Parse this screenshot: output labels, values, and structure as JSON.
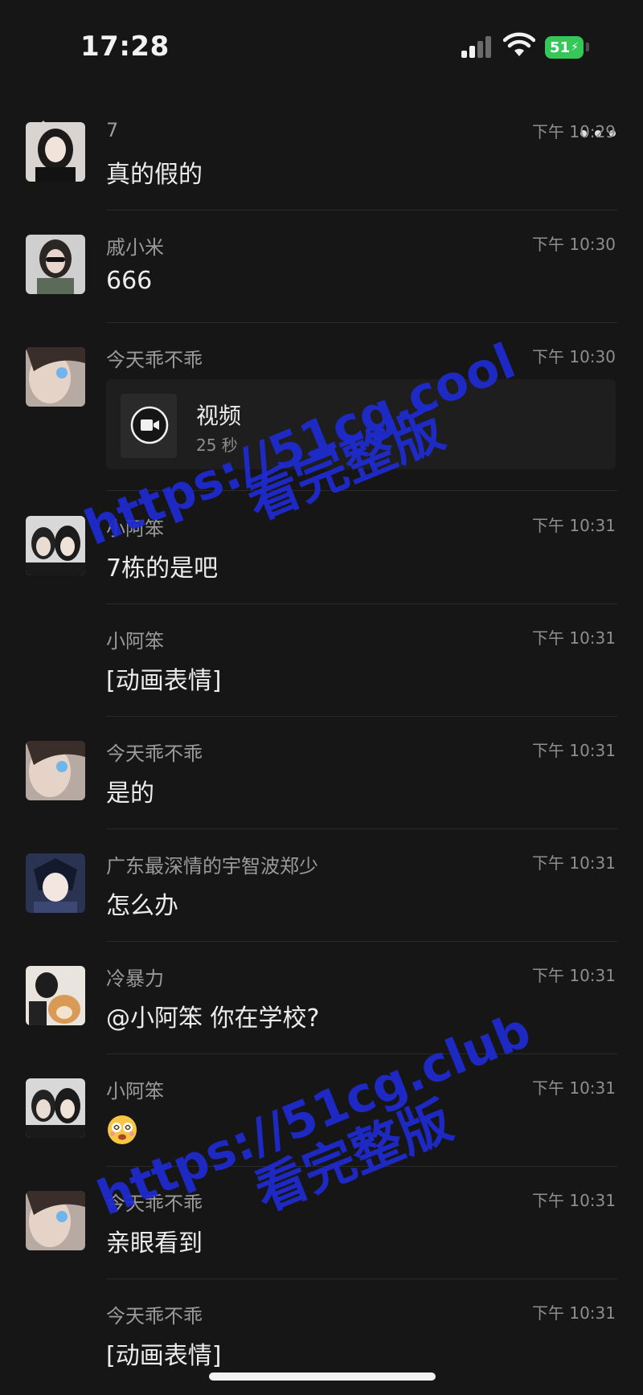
{
  "status_bar": {
    "time": "17:28",
    "battery": "51"
  },
  "messages": [
    {
      "sender": "7",
      "time": "下午 10:29",
      "text": "真的假的",
      "type": "text",
      "avatar": "avatar-girl-dark-hair"
    },
    {
      "sender": "戚小米",
      "time": "下午 10:30",
      "text": "666",
      "type": "text",
      "avatar": "avatar-girl-sunglasses"
    },
    {
      "sender": "今天乖不乖",
      "time": "下午 10:30",
      "type": "video",
      "video": {
        "title": "视频",
        "duration": "25 秒"
      },
      "avatar": "avatar-girl-blue-eye"
    },
    {
      "sender": "小阿笨",
      "time": "下午 10:31",
      "text": "7栋的是吧",
      "type": "text",
      "avatar": "avatar-couple"
    },
    {
      "sender": "小阿笨",
      "time": "下午 10:31",
      "text": "[动画表情]",
      "type": "text",
      "avatar": ""
    },
    {
      "sender": "今天乖不乖",
      "time": "下午 10:31",
      "text": "是的",
      "type": "text",
      "avatar": "avatar-girl-blue-eye"
    },
    {
      "sender": "广东最深情的宇智波郑少",
      "time": "下午 10:31",
      "text": "怎么办",
      "type": "text",
      "avatar": "avatar-anime-boy"
    },
    {
      "sender": "冷暴力",
      "time": "下午 10:31",
      "text": "@小阿笨 你在学校?",
      "type": "text",
      "avatar": "avatar-person-with-dog"
    },
    {
      "sender": "小阿笨",
      "time": "下午 10:31",
      "type": "emoji",
      "emoji": "dizzy-face-emoji",
      "avatar": "avatar-couple"
    },
    {
      "sender": "今天乖不乖",
      "time": "下午 10:31",
      "text": "亲眼看到",
      "type": "text",
      "avatar": "avatar-girl-blue-eye"
    },
    {
      "sender": "今天乖不乖",
      "time": "下午 10:31",
      "text": "[动画表情]",
      "type": "text",
      "avatar": ""
    }
  ],
  "watermarks": [
    {
      "url": "https://51cg.cool",
      "caption": "看完整版"
    },
    {
      "url": "https://51cg.club",
      "caption": "看完整版"
    }
  ],
  "colors": {
    "background": "#161616",
    "watermark": "#1f2bd1",
    "battery": "#36c759"
  }
}
